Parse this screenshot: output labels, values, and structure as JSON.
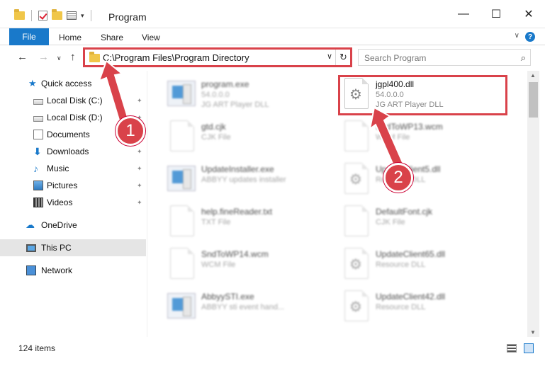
{
  "window": {
    "title": "Program",
    "controls": {
      "minimize": "—",
      "maximize": "☐",
      "close": "✕"
    }
  },
  "ribbon": {
    "tabs": [
      "File",
      "Home",
      "Share",
      "View"
    ],
    "help": "?"
  },
  "nav": {
    "back": "←",
    "forward": "→",
    "recent": "∨",
    "up": "↑",
    "address": "C:\\Program Files\\Program Directory",
    "refresh": "↻",
    "search_placeholder": "Search Program",
    "search_icon": "⌕"
  },
  "sidebar": {
    "items": [
      {
        "label": "Quick access",
        "icon": "star-icon",
        "pinned": false
      },
      {
        "label": "Local Disk (C:)",
        "icon": "disk-icon",
        "pinned": true
      },
      {
        "label": "Local Disk (D:)",
        "icon": "disk-icon",
        "pinned": true
      },
      {
        "label": "Documents",
        "icon": "documents-icon",
        "pinned": true
      },
      {
        "label": "Downloads",
        "icon": "downloads-icon",
        "pinned": true
      },
      {
        "label": "Music",
        "icon": "music-icon",
        "pinned": true
      },
      {
        "label": "Pictures",
        "icon": "pictures-icon",
        "pinned": true
      },
      {
        "label": "Videos",
        "icon": "videos-icon",
        "pinned": true
      },
      {
        "label": "OneDrive",
        "icon": "onedrive-icon",
        "pinned": false
      },
      {
        "label": "This PC",
        "icon": "this-pc-icon",
        "pinned": false,
        "selected": true
      },
      {
        "label": "Network",
        "icon": "network-icon",
        "pinned": false
      }
    ],
    "pin_glyph": "📌"
  },
  "files": [
    {
      "name": "program.exe",
      "line2": "54.0.0.0",
      "line3": "JG ART Player DLL",
      "blurred": true
    },
    {
      "name": "jgpl400.dll",
      "line2": "54.0.0.0",
      "line3": "JG ART Player DLL",
      "blurred": false
    },
    {
      "name": "gtd.cjk",
      "line2": "CJK File",
      "line3": "",
      "blurred": true
    },
    {
      "name": "SndToWP13.wcm",
      "line2": "WCM File",
      "line3": "",
      "blurred": true
    },
    {
      "name": "UpdateInstaller.exe",
      "line2": "ABBYY updates installer",
      "line3": "",
      "blurred": true
    },
    {
      "name": "UpdateClient5.dll",
      "line2": "Resource DLL",
      "line3": "",
      "blurred": true
    },
    {
      "name": "help.fineReader.txt",
      "line2": "TXT File",
      "line3": "",
      "blurred": true
    },
    {
      "name": "DefaultFont.cjk",
      "line2": "CJK File",
      "line3": "",
      "blurred": true
    },
    {
      "name": "SndToWP14.wcm",
      "line2": "WCM File",
      "line3": "",
      "blurred": true
    },
    {
      "name": "UpdateClient65.dll",
      "line2": "Resource DLL",
      "line3": "",
      "blurred": true
    },
    {
      "name": "AbbyySTI.exe",
      "line2": "ABBYY sti event hand...",
      "line3": "",
      "blurred": true
    },
    {
      "name": "UpdateClient42.dll",
      "line2": "Resource DLL",
      "line3": "",
      "blurred": true
    }
  ],
  "status": {
    "item_count": "124 items"
  },
  "annotations": {
    "step1": "1",
    "step2": "2",
    "color": "#d9424a"
  }
}
